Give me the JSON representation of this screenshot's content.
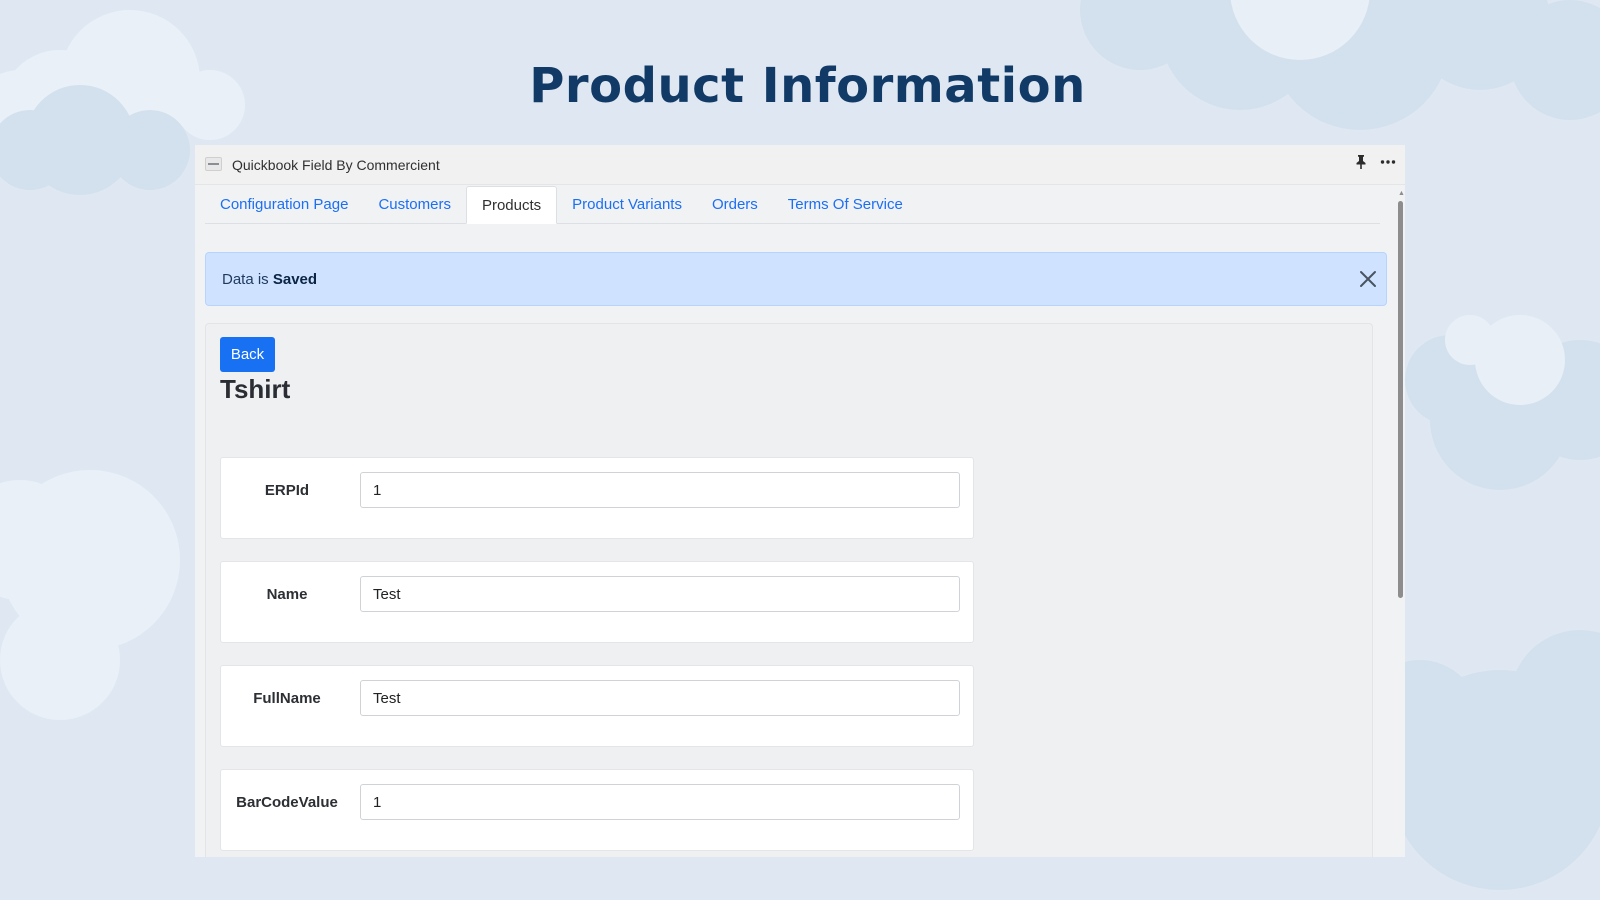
{
  "slide": {
    "title": "Product Information"
  },
  "app": {
    "title": "Quickbook Field By Commercient"
  },
  "tabs": [
    {
      "label": "Configuration Page",
      "active": false
    },
    {
      "label": "Customers",
      "active": false
    },
    {
      "label": "Products",
      "active": true
    },
    {
      "label": "Product Variants",
      "active": false
    },
    {
      "label": "Orders",
      "active": false
    },
    {
      "label": "Terms Of Service",
      "active": false
    }
  ],
  "alert": {
    "prefix": "Data is",
    "emphasis": "Saved"
  },
  "product": {
    "back_label": "Back",
    "heading": "Tshirt",
    "fields": [
      {
        "label": "ERPId",
        "value": "1"
      },
      {
        "label": "Name",
        "value": "Test"
      },
      {
        "label": "FullName",
        "value": "Test"
      },
      {
        "label": "BarCodeValue",
        "value": "1"
      }
    ]
  },
  "colors": {
    "slide_background": "#dfe8f2",
    "title_color": "#123a66",
    "accent_blue": "#1870f3",
    "alert_background": "#cfe2ff"
  },
  "icons": {
    "pin": "pin-icon",
    "more": "more-icon",
    "close": "close-icon",
    "logo": "app-logo-icon"
  }
}
